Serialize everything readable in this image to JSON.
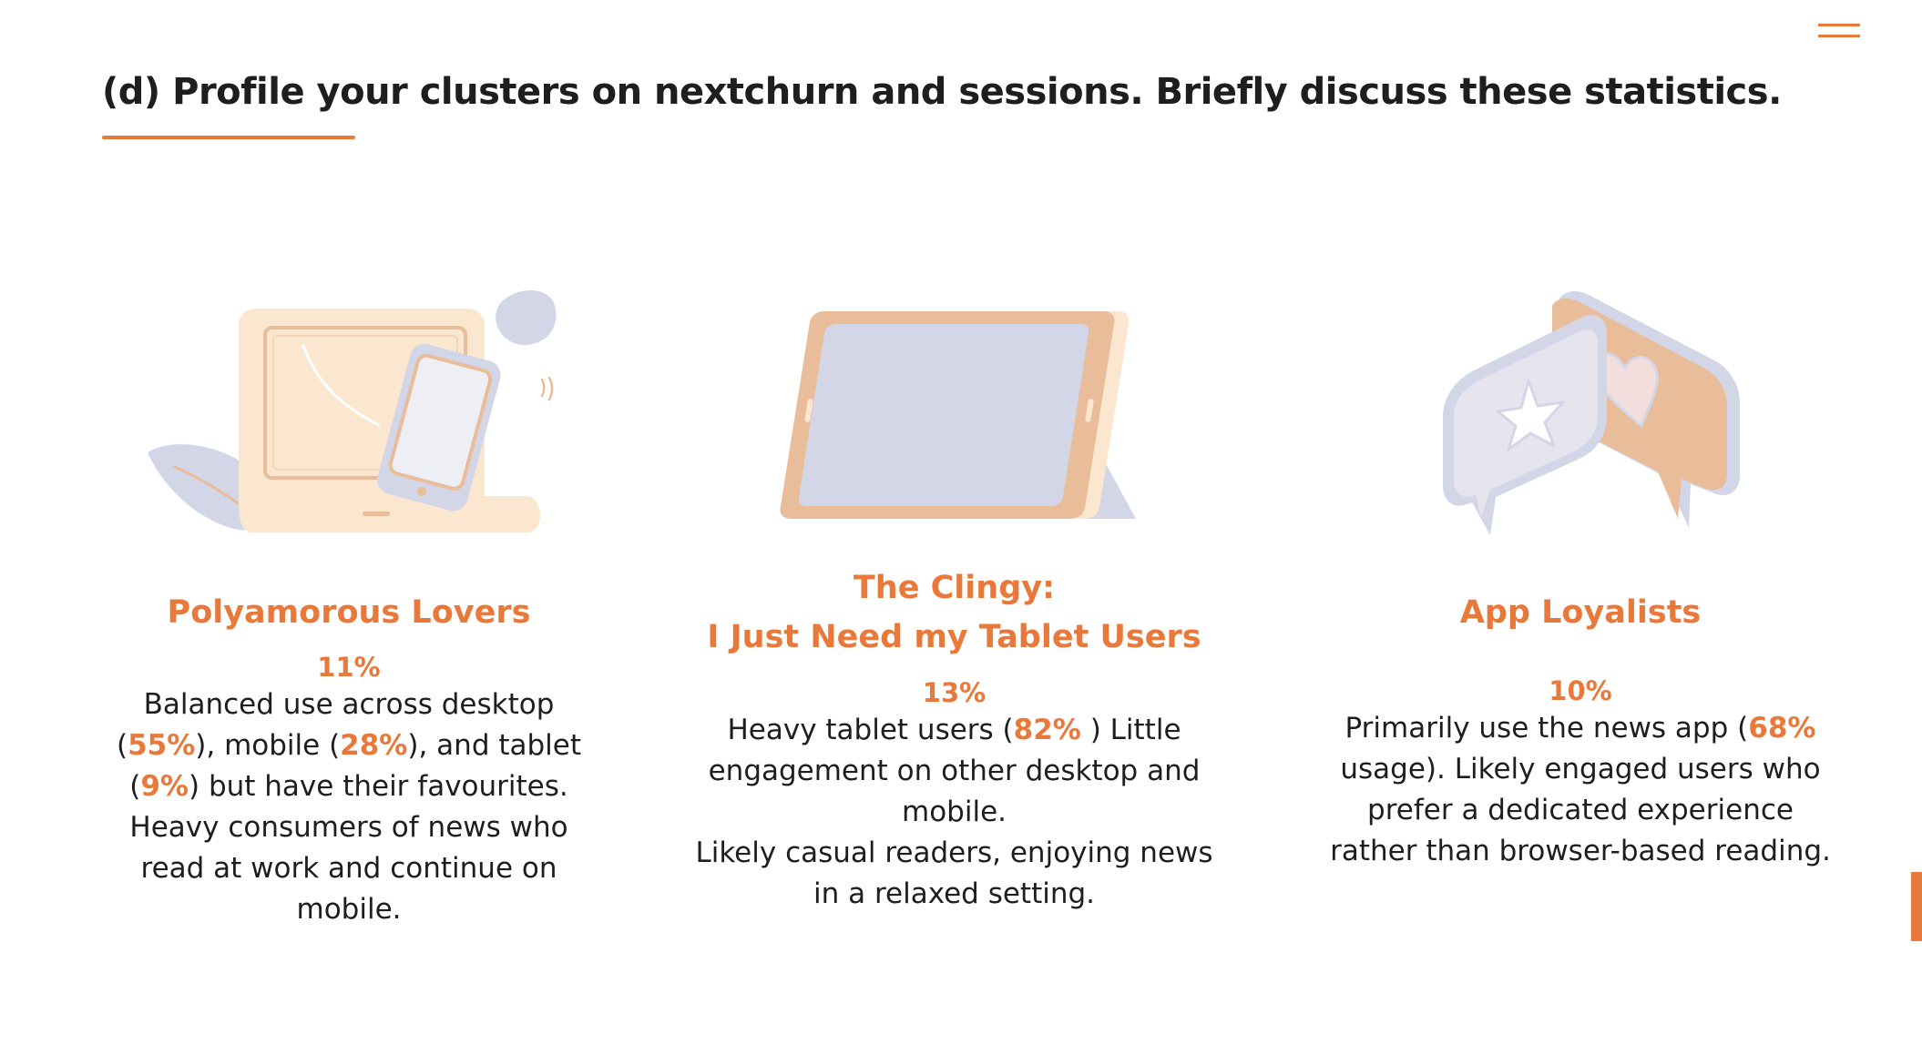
{
  "header": {
    "title": "(d) Profile your clusters on nextchurn and sessions. Briefly discuss these statistics.",
    "menu_icon": "hamburger-menu-icon"
  },
  "colors": {
    "accent": "#e8793a",
    "text": "#1e1e1e",
    "peach": "#fbe6cf",
    "salmon": "#e9bc9a",
    "lavender": "#d2d6e6",
    "background": "#ffffff"
  },
  "clusters": [
    {
      "illustration": "laptop-phone-icon",
      "title_lines": [
        "Polyamorous Lovers"
      ],
      "percent": "11%",
      "desc": {
        "p1": "Balanced use across desktop (",
        "h1": "55%",
        "p2": "), mobile (",
        "h2": "28%",
        "p3": "), and tablet (",
        "h3": "9%",
        "p4": ") but have their favourites. Heavy consumers of news who read at work and continue on mobile."
      }
    },
    {
      "illustration": "tablet-stand-icon",
      "title_lines": [
        "The Clingy:",
        "I Just Need my Tablet Users"
      ],
      "percent": "13%",
      "desc": {
        "p1": "Heavy tablet users (",
        "h1": "82%",
        "p2": " ) Little engagement on other desktop and mobile.",
        "p3": "Likely casual readers, enjoying news in a relaxed setting."
      }
    },
    {
      "illustration": "chat-bubbles-star-heart-icon",
      "title_lines": [
        "App Loyalists"
      ],
      "percent": "10%",
      "desc": {
        "p1": "Primarily use the news app (",
        "h1": "68%",
        "p2": " usage). Likely engaged users who prefer a dedicated experience rather than browser-based reading."
      }
    }
  ]
}
